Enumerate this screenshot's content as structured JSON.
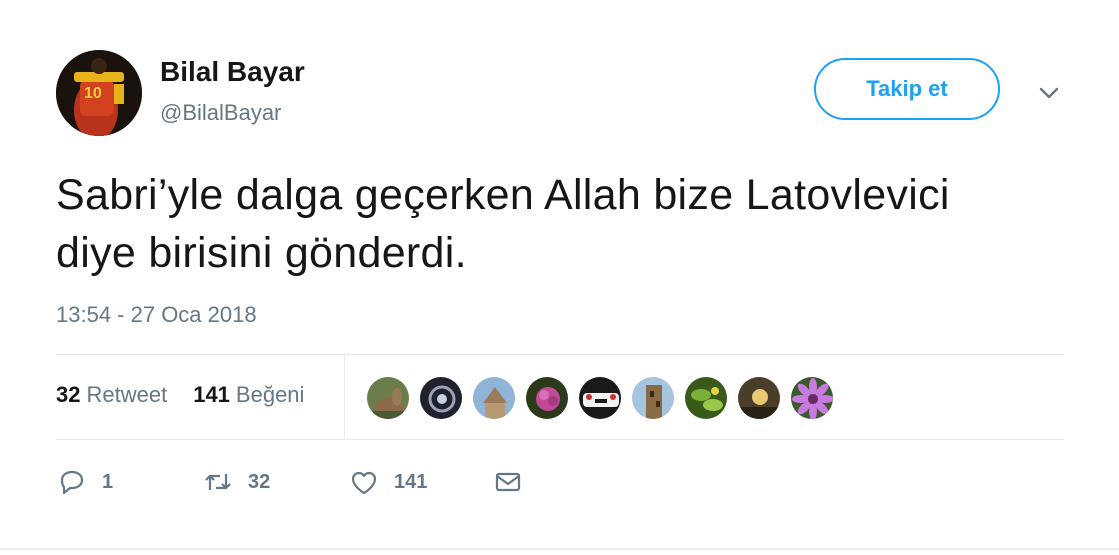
{
  "tweet": {
    "author": {
      "display_name": "Bilal Bayar",
      "screen_name": "@BilalBayar"
    },
    "follow_label": "Takip et",
    "text_line1": "Sabri’yle dalga geçerken Allah bize Latovlevici",
    "text_line2": "diye birisini gönderdi.",
    "timestamp": "13:54 - 27 Oca 2018"
  },
  "stats": {
    "retweets": "32",
    "retweets_label": "Retweet",
    "likes": "141",
    "likes_label": "Beğeni"
  },
  "likers": [
    {
      "icon": "liker-avatar-rabbit",
      "color": "#6b7d4a"
    },
    {
      "icon": "liker-avatar-dark-pattern",
      "color": "#2b2f3a"
    },
    {
      "icon": "liker-avatar-building",
      "color": "#8fb4d8"
    },
    {
      "icon": "liker-avatar-flower",
      "color": "#b24a8a"
    },
    {
      "icon": "liker-avatar-car",
      "color": "#e0e0e0"
    },
    {
      "icon": "liker-avatar-tower",
      "color": "#8a6b45"
    },
    {
      "icon": "liker-avatar-leaves",
      "color": "#6a9a2a"
    },
    {
      "icon": "liker-avatar-sunset",
      "color": "#6a5a3a"
    },
    {
      "icon": "liker-avatar-purple-flower",
      "color": "#c07ad8"
    }
  ],
  "actions": {
    "reply_count": "1",
    "retweet_count": "32",
    "like_count": "141"
  },
  "colors": {
    "accent": "#1da1f2",
    "muted": "#657786",
    "text": "#14171a",
    "divider": "#e6ecf0"
  }
}
